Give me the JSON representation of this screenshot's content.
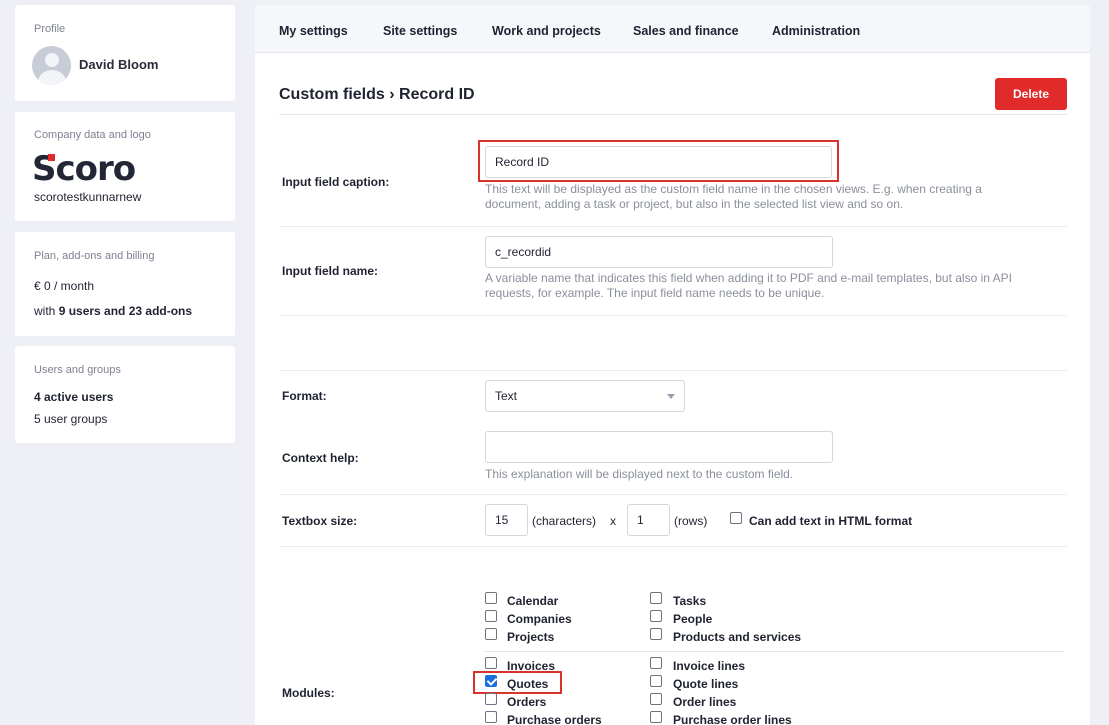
{
  "sidebar": {
    "profile": {
      "title": "Profile",
      "name": "David Bloom"
    },
    "company": {
      "title": "Company data and logo",
      "logo_text": "Scoro",
      "company_name": "scorotestkunnarnew"
    },
    "plan": {
      "title": "Plan, add-ons and billing",
      "price": "€ 0 / month",
      "with": "with",
      "users_addons": "9 users and 23 add-ons"
    },
    "users": {
      "title": "Users and groups",
      "active": "4 active users",
      "groups": "5 user groups"
    }
  },
  "nav": {
    "items": [
      "My settings",
      "Site settings",
      "Work and projects",
      "Sales and finance",
      "Administration"
    ]
  },
  "page": {
    "title": "Custom fields › Record ID",
    "delete_label": "Delete"
  },
  "form": {
    "caption": {
      "label": "Input field caption:",
      "value": "Record ID",
      "help": "This text will be displayed as the custom field name in the chosen views. E.g. when creating a",
      "help2": "document, adding a task or project, but also in the selected list view and so on."
    },
    "name": {
      "label": "Input field name:",
      "value": "c_recordid",
      "help": "A variable name that indicates this field when adding it to PDF and e-mail templates, but also in API",
      "help2": "requests, for example. The input field name needs to be unique."
    },
    "format": {
      "label": "Format:",
      "value": "Text"
    },
    "context": {
      "label": "Context help:",
      "value": "",
      "help": "This explanation will be displayed next to the custom field."
    },
    "textbox": {
      "label": "Textbox size:",
      "chars": "15",
      "chars_unit": "(characters)",
      "times": "x",
      "rows": "1",
      "rows_unit": "(rows)",
      "html_label": "Can add text in HTML format"
    },
    "modules": {
      "label": "Modules:",
      "left": [
        {
          "label": "Calendar",
          "checked": false
        },
        {
          "label": "Companies",
          "checked": false
        },
        {
          "label": "Projects",
          "checked": false
        },
        {
          "label": "Invoices",
          "checked": false
        },
        {
          "label": "Quotes",
          "checked": true
        },
        {
          "label": "Orders",
          "checked": false
        },
        {
          "label": "Purchase orders",
          "checked": false
        }
      ],
      "right": [
        {
          "label": "Tasks",
          "checked": false
        },
        {
          "label": "People",
          "checked": false
        },
        {
          "label": "Products and services",
          "checked": false
        },
        {
          "label": "Invoice lines",
          "checked": false
        },
        {
          "label": "Quote lines",
          "checked": false
        },
        {
          "label": "Order lines",
          "checked": false
        },
        {
          "label": "Purchase order lines",
          "checked": false
        }
      ]
    }
  },
  "colors": {
    "accent": "#e12b2b",
    "highlight": "#d9322e",
    "checkbox_on": "#1a6fe0"
  }
}
